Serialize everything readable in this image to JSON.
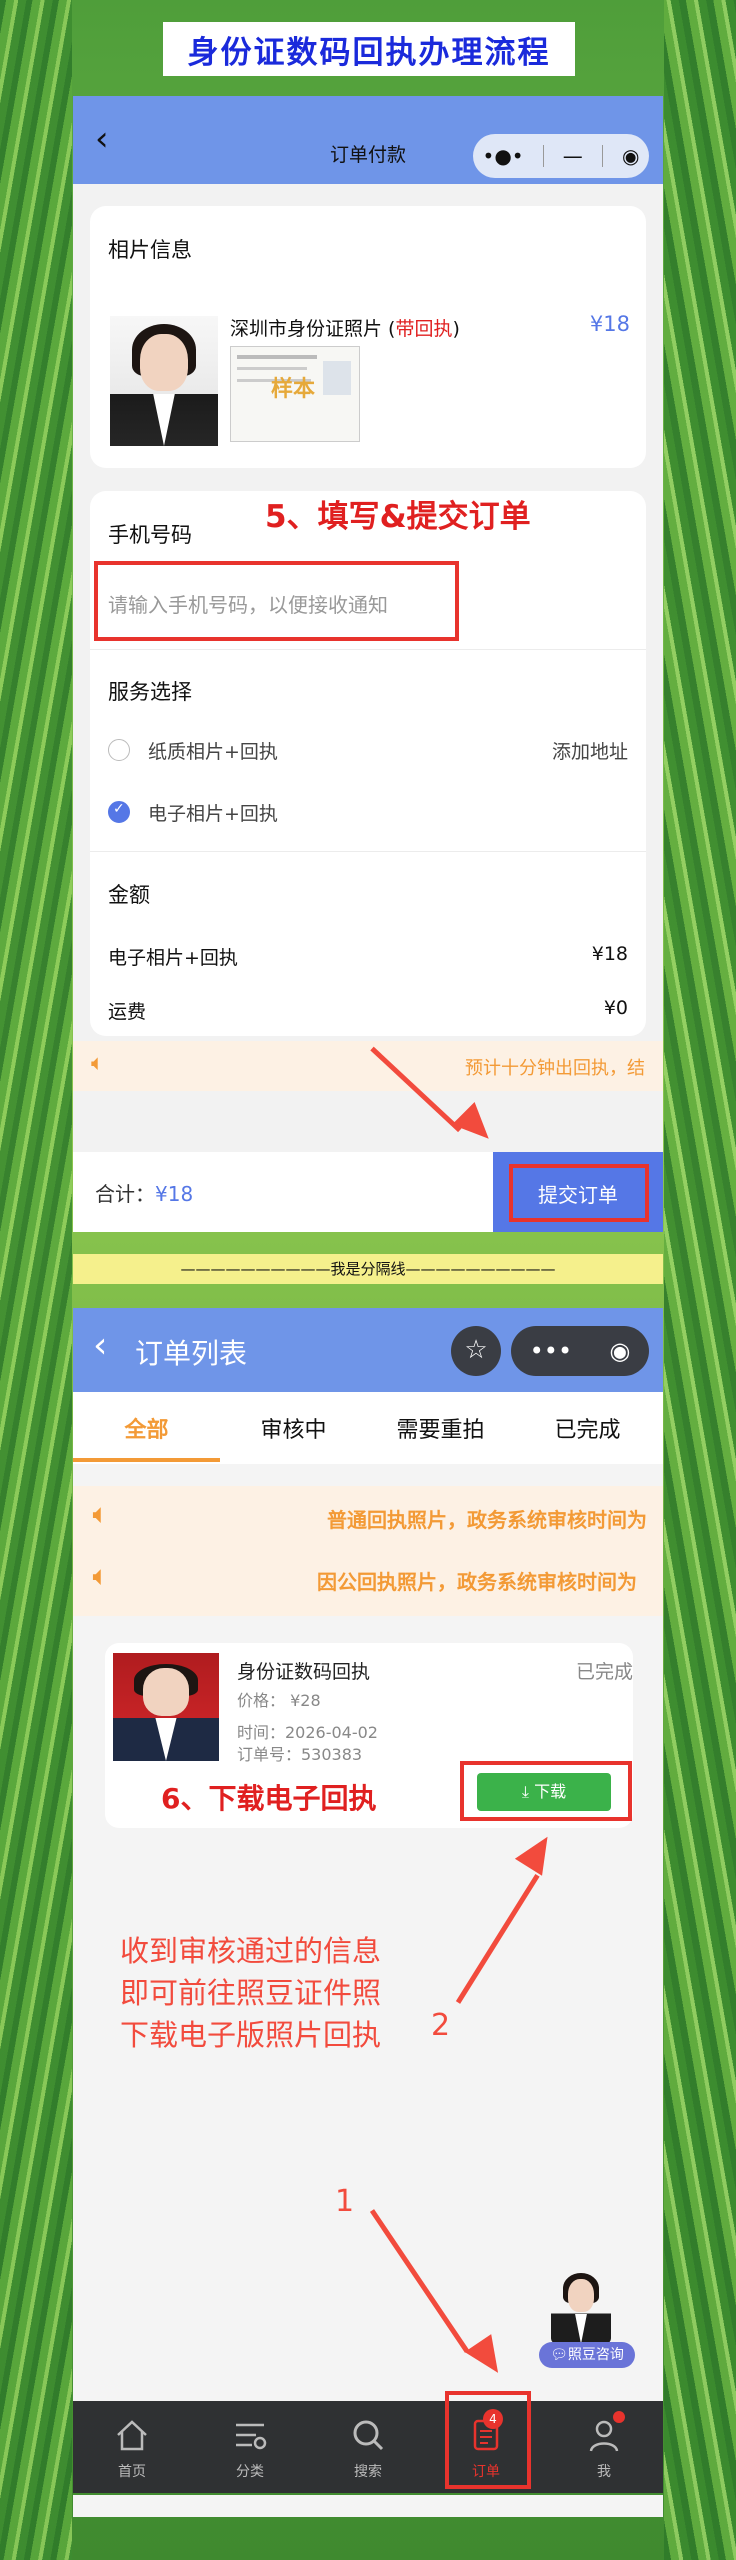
{
  "header": {
    "title": "身份证数码回执办理流程"
  },
  "order_page": {
    "nav_title": "订单付款",
    "back_icon": "chevron-left-icon",
    "capsule": {
      "more": "•●•",
      "minimize": "—",
      "close": "◉"
    },
    "photo_card": {
      "title": "相片信息",
      "product_prefix": "深圳市身份证照片 (",
      "product_highlight": "带回执",
      "product_suffix": ")",
      "price": "¥18",
      "receipt_stamp": "样本"
    },
    "phone_card": {
      "title": "手机号码",
      "annotation": "5、填写&提交订单",
      "input_placeholder": "请输入手机号码，以便接收通知"
    },
    "service": {
      "title": "服务选择",
      "options": [
        {
          "label": "纸质相片+回执",
          "selected": false,
          "extra": "添加地址"
        },
        {
          "label": "电子相片+回执",
          "selected": true,
          "extra": ""
        }
      ]
    },
    "amount": {
      "title": "金额",
      "rows": [
        {
          "label": "电子相片+回执",
          "value": "¥18"
        },
        {
          "label": "运费",
          "value": "¥0"
        }
      ]
    },
    "notice": "预计十分钟出回执，结",
    "footer": {
      "total_label": "合计：",
      "total_value": "¥18",
      "submit": "提交订单"
    }
  },
  "separator": "——————————我是分隔线——————————",
  "orders_page": {
    "nav_title": "订单列表",
    "tabs": [
      "全部",
      "审核中",
      "需要重拍",
      "已完成"
    ],
    "active_tab": 0,
    "notices": [
      "普通回执照片，政务系统审核时间为",
      "因公回执照片，政务系统审核时间为"
    ],
    "order": {
      "title": "身份证数码回执",
      "status": "已完成",
      "price": "价格： ¥28",
      "time": "时间：2026-04-02",
      "order_no": "订单号：530383",
      "download": "下载"
    },
    "annotation_download": "6、下载电子回执",
    "annotation_info": [
      "收到审核通过的信息",
      "即可前往照豆证件照",
      "下载电子版照片回执"
    ],
    "step_2": "2",
    "step_1": "1",
    "consult_label": "照豆咨询",
    "tabbar": [
      {
        "label": "首页",
        "icon": "home-icon",
        "badge": ""
      },
      {
        "label": "分类",
        "icon": "category-icon",
        "badge": ""
      },
      {
        "label": "搜索",
        "icon": "search-icon",
        "badge": ""
      },
      {
        "label": "订单",
        "icon": "order-icon",
        "badge": "4"
      },
      {
        "label": "我",
        "icon": "profile-icon",
        "badge": ""
      }
    ]
  },
  "colors": {
    "title_blue": "#1a2adb",
    "nav_blue": "#6f95e8",
    "accent_blue": "#5577e6",
    "annotation_red": "#e02020",
    "notice_orange": "#f39a36",
    "active_tab_orange": "#f39a36",
    "download_green": "#3bb24a"
  }
}
